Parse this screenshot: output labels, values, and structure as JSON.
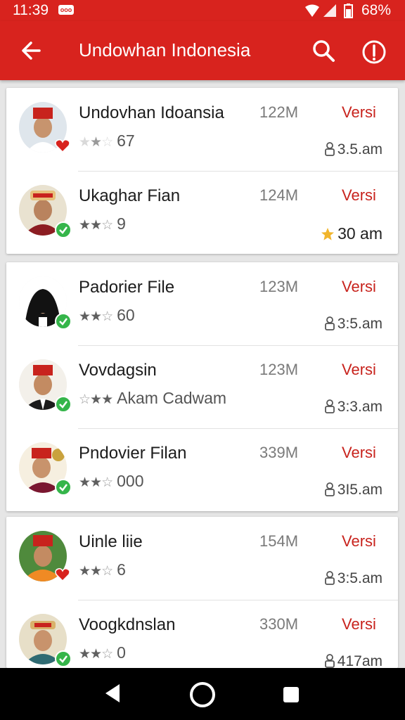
{
  "status_bar": {
    "time": "11:39",
    "carrier_badge": "ooo",
    "battery_percent": "68%",
    "icons": [
      "wifi-icon",
      "signal-icon",
      "battery-icon"
    ]
  },
  "app_bar": {
    "title": "Undowhan Indonesia",
    "icons": [
      "back-arrow-icon",
      "search-icon",
      "info-icon"
    ],
    "color": "#d8231e"
  },
  "cards": [
    {
      "items": [
        {
          "name": "Undovhan Idoansia",
          "size": "122M",
          "action": "Versi",
          "stars": 1,
          "rating_text": "67",
          "time": "3.5.am",
          "time_icon": "person-icon",
          "badge": "heart"
        },
        {
          "name": "Ukaghar Fian",
          "size": "124M",
          "action": "Versi",
          "stars": 2,
          "rating_text": "9",
          "time": "30 am",
          "time_icon": "star-icon",
          "badge": "check"
        }
      ]
    },
    {
      "items": [
        {
          "name": "Padorier File",
          "size": "123M",
          "action": "Versi",
          "stars": 2,
          "rating_text": "60",
          "time": "3:5.am",
          "time_icon": "person-icon",
          "badge": "check"
        },
        {
          "name": "Vovdagsin",
          "size": "123M",
          "action": "Versi",
          "stars": 2,
          "rating_text": "Akam Cadwam",
          "time": "3:3.am",
          "time_icon": "person-icon",
          "badge": "check"
        },
        {
          "name": "Pndovier Filan",
          "size": "339M",
          "action": "Versi",
          "stars": 2,
          "rating_text": "000",
          "time": "3I5.am",
          "time_icon": "person-icon",
          "badge": "check"
        }
      ]
    },
    {
      "items": [
        {
          "name": "Uinle liie",
          "size": "154M",
          "action": "Versi",
          "stars": 2,
          "rating_text": "6",
          "time": "3:5.am",
          "time_icon": "person-icon",
          "badge": "heart"
        },
        {
          "name": "Voogkdnslan",
          "size": "330M",
          "action": "Versi",
          "stars": 2,
          "rating_text": "0",
          "time": "417am",
          "time_icon": "person-icon",
          "badge": "check"
        }
      ]
    }
  ],
  "nav_bar": {
    "icons": [
      "back-triangle-icon",
      "home-circle-icon",
      "recents-square-icon"
    ]
  },
  "colors": {
    "accent": "#d8231e",
    "versi_text": "#c8231d",
    "check_badge": "#35b54a"
  }
}
